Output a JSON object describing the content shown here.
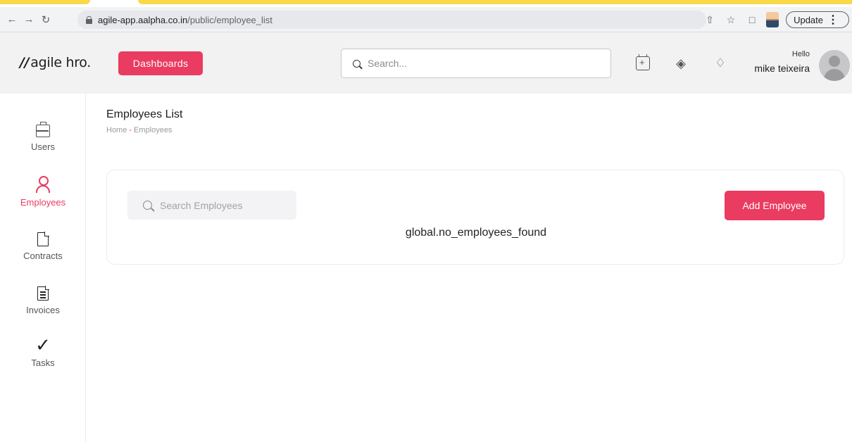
{
  "browser": {
    "url_host": "agile-app.aalpha.co.in",
    "url_path": "/public/employee_list",
    "update_label": "Update"
  },
  "header": {
    "logo_text": "agile hro.",
    "dashboards_label": "Dashboards",
    "search_placeholder": "Search...",
    "greeting": "Hello",
    "username": "mike teixeira"
  },
  "sidebar": {
    "items": [
      {
        "label": "Users",
        "icon": "briefcase-icon"
      },
      {
        "label": "Employees",
        "icon": "person-icon"
      },
      {
        "label": "Contracts",
        "icon": "document-icon"
      },
      {
        "label": "Invoices",
        "icon": "invoice-icon"
      },
      {
        "label": "Tasks",
        "icon": "checkmark-icon"
      }
    ]
  },
  "main": {
    "title": "Employees List",
    "breadcrumb": [
      "Home",
      "-",
      "Employees"
    ],
    "search_placeholder": "Search Employees",
    "add_button": "Add Employee",
    "empty_message": "global.no_employees_found"
  },
  "colors": {
    "accent": "#ea3b60",
    "header_bg": "#f2f2f3"
  }
}
